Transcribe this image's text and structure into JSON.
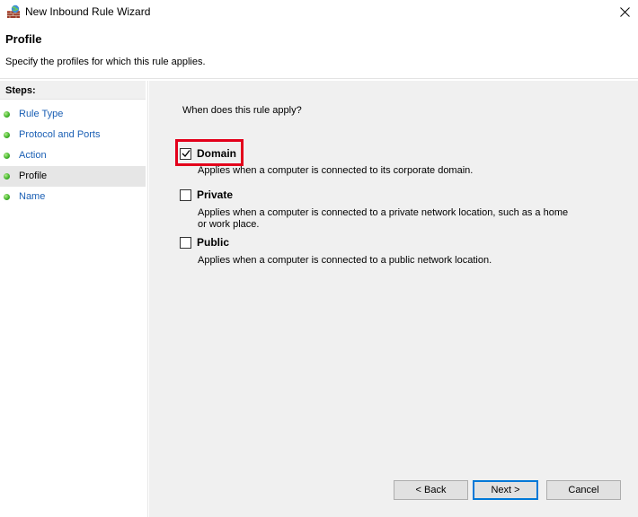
{
  "window": {
    "title": "New Inbound Rule Wizard",
    "close_glyph": "✕"
  },
  "header": {
    "title": "Profile",
    "subtitle": "Specify the profiles for which this rule applies."
  },
  "sidebar": {
    "steps_label": "Steps:",
    "items": [
      {
        "label": "Rule Type",
        "current": false
      },
      {
        "label": "Protocol and Ports",
        "current": false
      },
      {
        "label": "Action",
        "current": false
      },
      {
        "label": "Profile",
        "current": true
      },
      {
        "label": "Name",
        "current": false
      }
    ]
  },
  "main": {
    "question": "When does this rule apply?",
    "options": [
      {
        "label": "Domain",
        "checked": true,
        "description": "Applies when a computer is connected to its corporate domain."
      },
      {
        "label": "Private",
        "checked": false,
        "description": "Applies when a computer is connected to a private network location, such as a home or work place."
      },
      {
        "label": "Public",
        "checked": false,
        "description": "Applies when a computer is connected to a public network location."
      }
    ]
  },
  "buttons": {
    "back": "< Back",
    "next": "Next >",
    "cancel": "Cancel"
  },
  "colors": {
    "link": "#1a5fb4",
    "panel": "#f0f0f0",
    "highlight": "#e3001b",
    "primary_border": "#0078d7"
  },
  "icons": {
    "app": "firewall-wall-icon",
    "close": "close-icon",
    "step": "green-dot-icon",
    "check": "check-mark-icon"
  }
}
